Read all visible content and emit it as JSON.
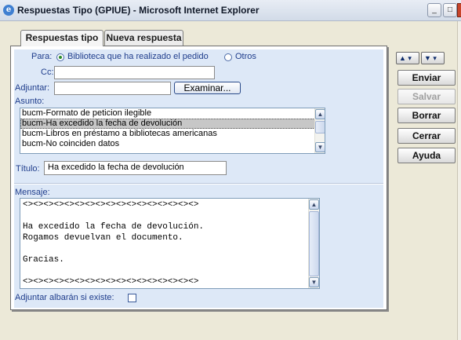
{
  "window": {
    "title": "Respuestas Tipo (GPIUE) - Microsoft Internet Explorer",
    "icon": "ie-icon",
    "controls": {
      "minimize": "_",
      "maximize": "□"
    }
  },
  "tabs": [
    {
      "label": "Respuestas tipo",
      "active": true
    },
    {
      "label": "Nueva respuesta",
      "active": false
    }
  ],
  "form": {
    "para_label": "Para:",
    "radio_options": [
      {
        "label": "Biblioteca que ha realizado el pedido",
        "checked": true
      },
      {
        "label": "Otros",
        "checked": false
      }
    ],
    "cc_label": "Cc:",
    "cc_value": "",
    "adjuntar_label": "Adjuntar:",
    "adjuntar_value": "",
    "examinar_label": "Examinar...",
    "asunto_label": "Asunto:",
    "asunto_items": [
      "bucm-Formato de peticion ilegible",
      "bucm-Ha excedido la fecha de devolución",
      "bucm-Libros en préstamo a bibliotecas americanas",
      "bucm-No coinciden datos"
    ],
    "asunto_selected_index": 1,
    "titulo_label": "Título:",
    "titulo_value": "Ha excedido la fecha de devolución",
    "mensaje_label": "Mensaje:",
    "mensaje_lines": [
      "<><><><><><><><><><><><><><><><><>",
      "",
      "Ha excedido la fecha de devolución.",
      "Rogamos devuelvan el documento.",
      "",
      "Gracias.",
      "",
      "<><><><><><><><><><><><><><><><><>"
    ],
    "albaran_label": "Adjuntar albarán si existe:",
    "albaran_checked": false
  },
  "sidebar": {
    "buttons": [
      {
        "label": "Enviar",
        "enabled": true
      },
      {
        "label": "Salvar",
        "enabled": false
      },
      {
        "label": "Borrar",
        "enabled": true
      },
      {
        "label": "Cerrar",
        "enabled": true
      },
      {
        "label": "Ayuda",
        "enabled": true
      }
    ]
  },
  "colors": {
    "panel_bg": "#dde8f7",
    "label_blue": "#1f3d8c",
    "selected_row": "#c7c7c7",
    "window_bg": "#ece9d8"
  }
}
